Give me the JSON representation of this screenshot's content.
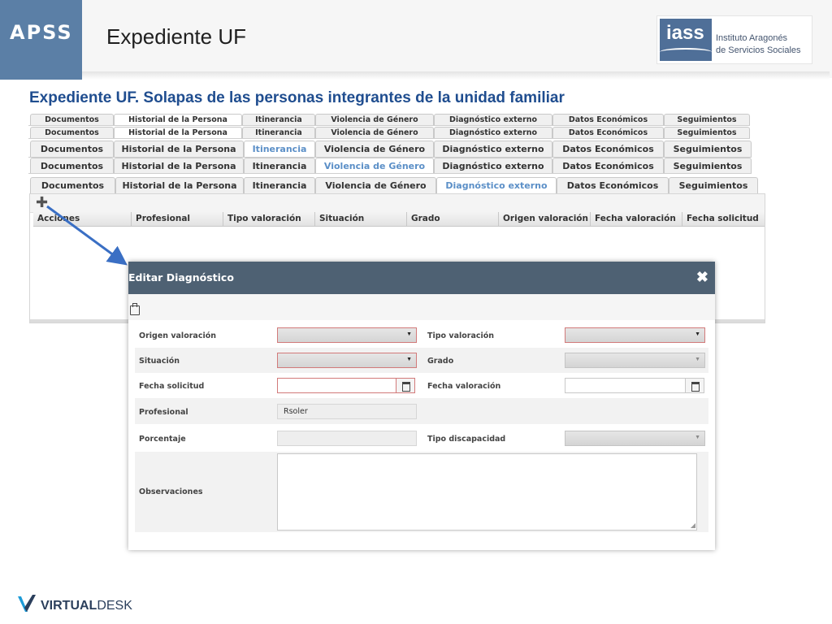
{
  "header": {
    "brand": "APSS",
    "title": "Expediente UF",
    "logo_word": "iass",
    "logo_line1": "Instituto Aragonés",
    "logo_line2": "de Servicios Sociales"
  },
  "subtitle": "Expediente UF. Solapas de las personas integrantes de la unidad familiar",
  "tab_rows": [
    [
      "Documentos",
      "Historial de la Persona",
      "Itinerancia",
      "Violencia de Género",
      "Diagnóstico externo",
      "Datos Económicos",
      "Seguimientos"
    ],
    [
      "Documentos",
      "Historial de la Persona",
      "Itinerancia",
      "Violencia de Género",
      "Diagnóstico externo",
      "Datos Económicos",
      "Seguimientos"
    ],
    [
      "Documentos",
      "Historial de la Persona",
      "Itinerancia",
      "Violencia de Género",
      "Diagnóstico externo",
      "Datos Económicos",
      "Seguimientos"
    ],
    [
      "Documentos",
      "Historial de la Persona",
      "Itinerancia",
      "Violencia de Género",
      "Diagnóstico externo",
      "Datos Económicos",
      "Seguimientos"
    ],
    [
      "Documentos",
      "Historial de la Persona",
      "Itinerancia",
      "Violencia de Género",
      "Diagnóstico externo",
      "Datos Económicos",
      "Seguimientos"
    ]
  ],
  "active_tabs": [
    "Historial de la Persona",
    "Historial de la Persona",
    "Itinerancia",
    "Violencia de Género",
    "Diagnóstico externo"
  ],
  "grid": {
    "columns": [
      "Acciones",
      "Profesional",
      "Tipo valoración",
      "Situación",
      "Grado",
      "Origen valoración",
      "Fecha valoración",
      "Fecha solicitud"
    ]
  },
  "modal": {
    "title": "Editar Diagnóstico",
    "labels": {
      "origen": "Origen valoración",
      "tipo_valoracion": "Tipo valoración",
      "situacion": "Situación",
      "grado": "Grado",
      "fecha_solicitud": "Fecha solicitud",
      "fecha_valoracion": "Fecha valoración",
      "profesional": "Profesional",
      "porcentaje": "Porcentaje",
      "tipo_discapacidad": "Tipo discapacidad",
      "observaciones": "Observaciones"
    },
    "values": {
      "profesional": "Rsoler",
      "origen": "",
      "tipo_valoracion": "",
      "situacion": "",
      "grado": "",
      "fecha_solicitud": "",
      "fecha_valoracion": "",
      "porcentaje": "",
      "tipo_discapacidad": "",
      "observaciones": ""
    }
  },
  "icons": {
    "add": "plus-icon",
    "close": "close-icon",
    "save": "save-icon",
    "calendar": "calendar-icon",
    "dropdown": "chevron-down-icon"
  },
  "footer": {
    "logo_bold": "VIRTUAL",
    "logo_thin": "DESK"
  },
  "colors": {
    "brand_blue": "#5b7fa6",
    "subtitle_blue": "#1f4d8f",
    "modal_header": "#4e6173",
    "required_border": "#d27a7a",
    "active_tab_text": "#5b8fc7"
  }
}
